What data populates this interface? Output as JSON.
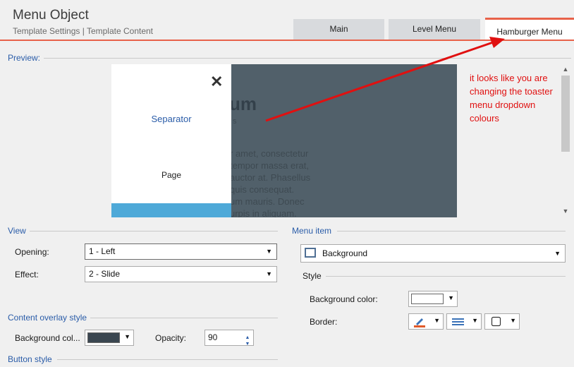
{
  "header": {
    "title": "Menu Object",
    "breadcrumb": "Template Settings | Template Content",
    "tabs": [
      {
        "label": "Main",
        "active": false
      },
      {
        "label": "Level Menu",
        "active": false
      },
      {
        "label": "Hamburger Menu",
        "active": true
      }
    ],
    "accent_color": "#e8624a"
  },
  "preview": {
    "label": "Preview:",
    "drawer": {
      "close_glyph": "✕",
      "separator_label": "Separator",
      "page_label": "Page"
    },
    "background_heading": "um",
    "background_subtext": "s",
    "background_lines": [
      "r amet, consectetur",
      "tempor massa erat,",
      "auctor at. Phasellus",
      "quis    consequat.",
      "um mauris. Donec",
      "urpis  in  aliquam."
    ]
  },
  "annotation": {
    "text": "it looks like you are changing the toaster menu dropdown colours",
    "color": "#e01010"
  },
  "view": {
    "section_label": "View",
    "opening_label": "Opening:",
    "opening_value": "1 - Left",
    "effect_label": "Effect:",
    "effect_value": "2 - Slide"
  },
  "content_overlay": {
    "section_label": "Content overlay style",
    "bg_color_label": "Background col...",
    "bg_color": "#3a4650",
    "opacity_label": "Opacity:",
    "opacity_value": "90"
  },
  "button_style": {
    "section_label": "Button style"
  },
  "menu_item": {
    "section_label": "Menu item",
    "selected_value": "Background",
    "style_label": "Style",
    "bg_color_label": "Background color:",
    "bg_color": "#ffffff",
    "border_label": "Border:"
  },
  "icons": {
    "dropdown": "chevron-down-icon",
    "pen": "pen-color-icon",
    "lines": "border-lines-icon",
    "box": "border-box-icon"
  }
}
